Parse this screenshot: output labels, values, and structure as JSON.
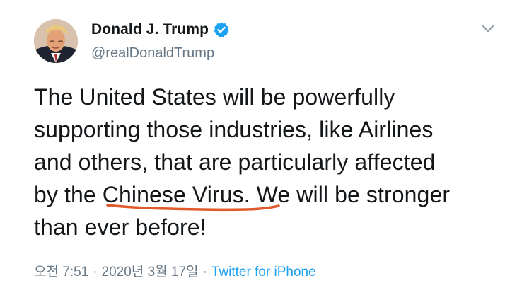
{
  "tweet": {
    "author": {
      "display_name": "Donald J. Trump",
      "handle": "@realDonaldTrump",
      "verified": true
    },
    "text_lines": [
      "The United States will be powerfully",
      "supporting those industries, like Airlines",
      "and others, that are particularly affected",
      "by the ",
      "Chinese Virus",
      ". We will be stronger",
      "than ever before!"
    ],
    "meta": {
      "time": "오전 7:51",
      "separator": "·",
      "date": "2020년 3월 17일",
      "source": "Twitter for iPhone"
    },
    "icons": {
      "verified": "verified-badge-icon",
      "menu": "chevron-down-icon"
    },
    "colors": {
      "verified_badge": "#1da1f2",
      "source_link": "#1da1f2",
      "meta_text": "#657786",
      "annotation_underline": "#e05a2b"
    }
  }
}
